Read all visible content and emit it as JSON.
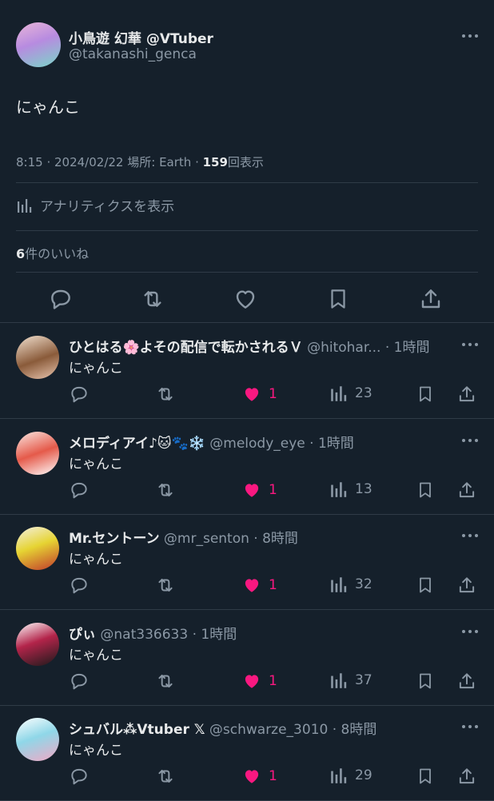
{
  "tweet": {
    "author_name": "小鳥遊 幻華 @VTuber",
    "author_handle": "@takanashi_genca",
    "text": "にゃんこ",
    "time": "8:15",
    "date": "2024/02/22",
    "location_label": "場所: Earth",
    "views_count": "159",
    "views_label": "回表示",
    "analytics_label": "アナリティクスを表示",
    "likes_count": "6",
    "likes_label": "件のいいね"
  },
  "colors": {
    "background": "#15202b",
    "like_pink": "#f91880",
    "muted": "#8b98a5"
  },
  "replies": [
    {
      "name": "ひとはる🌸よその配信で転かされるＶ",
      "handle": "@hitohar...",
      "time": "· 1時間",
      "text": "にゃんこ",
      "likes": "1",
      "views": "23"
    },
    {
      "name": "メロディアイ♪🐱🐾❄️",
      "handle": "@melody_eye",
      "time": "· 1時間",
      "text": "にゃんこ",
      "likes": "1",
      "views": "13"
    },
    {
      "name": "Mr.セントーン",
      "handle": "@mr_senton",
      "time": "· 8時間",
      "text": "にゃんこ",
      "likes": "1",
      "views": "32"
    },
    {
      "name": "ぴぃ",
      "handle": "@nat336633",
      "time": "· 1時間",
      "text": "にゃんこ",
      "likes": "1",
      "views": "37"
    },
    {
      "name": "シュバル⁂Vtuber 𝕏",
      "handle": "@schwarze_3010",
      "time": "· 8時間",
      "text": "にゃんこ",
      "likes": "1",
      "views": "29"
    }
  ],
  "icons": [
    "reply-icon",
    "retweet-icon",
    "like-icon",
    "bookmark-icon",
    "share-icon",
    "analytics-icon",
    "more-icon"
  ]
}
